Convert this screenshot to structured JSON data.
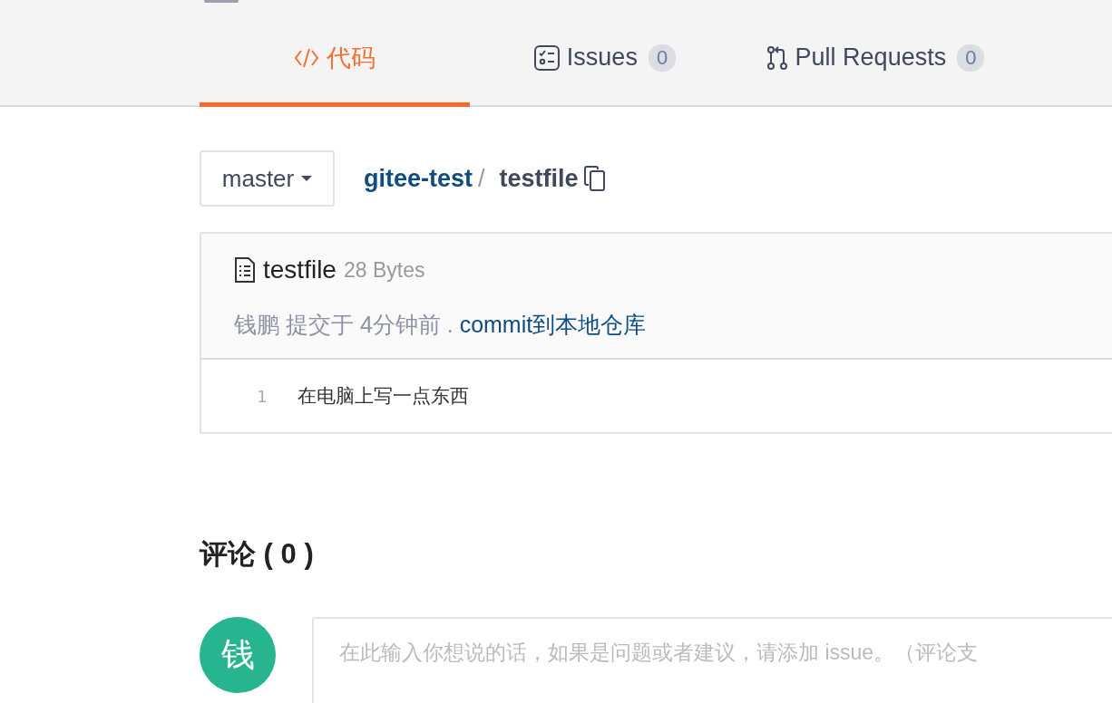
{
  "tabs": [
    {
      "kind": "code",
      "label": "代码",
      "selected": true
    },
    {
      "kind": "issues",
      "label": "Issues",
      "count": "0",
      "selected": false
    },
    {
      "kind": "pulls",
      "label": "Pull Requests",
      "count": "0",
      "selected": false
    }
  ],
  "branch": "master",
  "path": {
    "repo": "gitee-test",
    "separator": "/",
    "file": "testfile"
  },
  "file": {
    "name": "testfile",
    "size": "28 Bytes",
    "author": "钱鹏",
    "action": "提交于",
    "time": "4分钟前",
    "dot": ".",
    "message": "commit到本地仓库",
    "lines": [
      {
        "number": "1",
        "text": "在电脑上写一点东西"
      }
    ]
  },
  "comments": {
    "title": "评论 ( 0 )",
    "avatar": "钱",
    "placeholder": "在此输入你想说的话，如果是问题或者建议，请添加 issue。（评论支"
  }
}
